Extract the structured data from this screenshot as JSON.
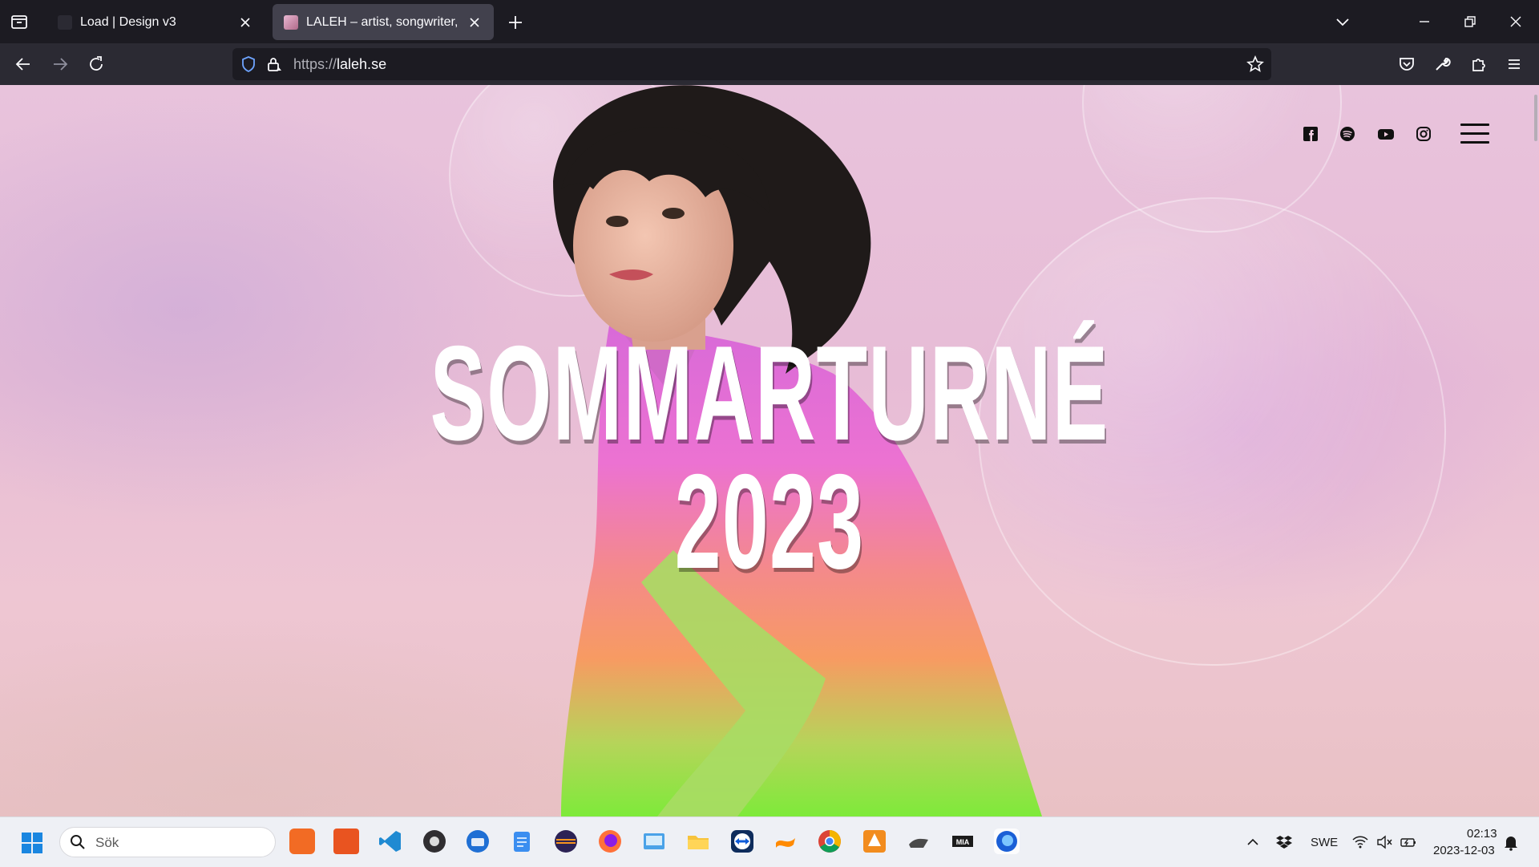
{
  "browser": {
    "tabs": [
      {
        "title": "Load | Design v3",
        "active": false
      },
      {
        "title": "LALEH – artist, songwriter, musi",
        "active": true
      }
    ],
    "url": {
      "protocol": "https://",
      "host": "laleh.se"
    },
    "icons": [
      "tab-list-icon",
      "close-icon",
      "new-tab-icon",
      "chevron-down-icon",
      "minimize-icon",
      "restore-icon",
      "window-close-icon",
      "back-icon",
      "forward-icon",
      "reload-icon",
      "shield-icon",
      "lock-icon",
      "bookmark-star-icon",
      "pocket-icon",
      "wrench-icon",
      "extensions-icon",
      "menu-icon"
    ]
  },
  "page": {
    "hero_line1": "SOMMARTURNÉ",
    "hero_line2": "2023",
    "social": [
      "facebook-icon",
      "spotify-icon",
      "youtube-icon",
      "instagram-icon"
    ]
  },
  "taskbar": {
    "search_placeholder": "Sök",
    "language": "SWE",
    "time": "02:13",
    "date": "2023-12-03",
    "apps": [
      "xampp",
      "ubuntu",
      "vscode",
      "obs",
      "thunderbird",
      "notepad",
      "eclipse",
      "firefox",
      "control-panel",
      "file-explorer",
      "teamviewer",
      "sublime",
      "chrome",
      "sourcetree",
      "inkscape",
      "mia",
      "firefox-dev"
    ]
  },
  "colors": {
    "tabbar_bg": "#1c1b22",
    "navbar_bg": "#2b2a33",
    "active_tab": "#42414d",
    "taskbar_bg": "#eef0f5",
    "hero_text": "#ffffff"
  }
}
